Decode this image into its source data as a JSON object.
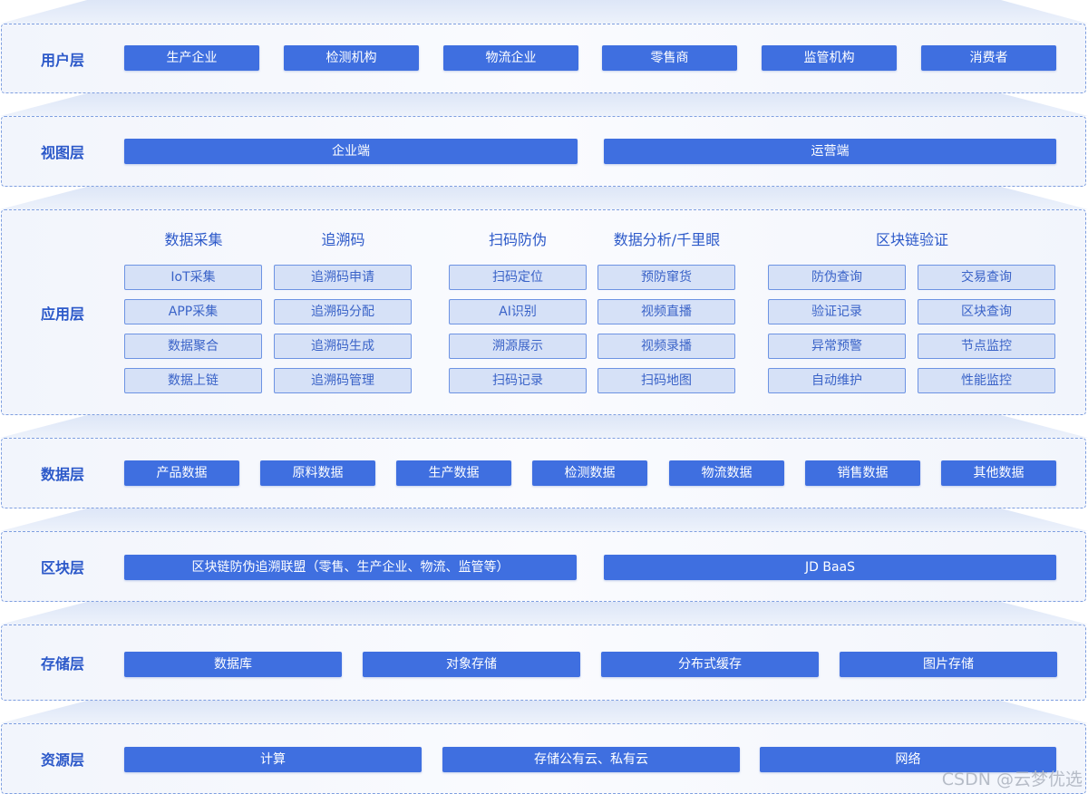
{
  "layers": {
    "user": {
      "label": "用户层",
      "items": [
        "生产企业",
        "检测机构",
        "物流企业",
        "零售商",
        "监管机构",
        "消费者"
      ]
    },
    "view": {
      "label": "视图层",
      "items": [
        "企业端",
        "运营端"
      ]
    },
    "app": {
      "label": "应用层",
      "groups": [
        {
          "title": "数据采集",
          "items": [
            "IoT采集",
            "APP采集",
            "数据聚合",
            "数据上链"
          ]
        },
        {
          "title": "追溯码",
          "items": [
            "追溯码申请",
            "追溯码分配",
            "追溯码生成",
            "追溯码管理"
          ]
        },
        {
          "title": "扫码防伪",
          "items": [
            "扫码定位",
            "AI识别",
            "溯源展示",
            "扫码记录"
          ]
        },
        {
          "title": "数据分析/千里眼",
          "items": [
            "预防窜货",
            "视频直播",
            "视频录播",
            "扫码地图"
          ]
        },
        {
          "title": "区块链验证",
          "items": [
            "防伪查询",
            "验证记录",
            "异常预警",
            "自动维护",
            "交易查询",
            "区块查询",
            "节点监控",
            "性能监控"
          ]
        }
      ]
    },
    "data": {
      "label": "数据层",
      "items": [
        "产品数据",
        "原料数据",
        "生产数据",
        "检测数据",
        "物流数据",
        "销售数据",
        "其他数据"
      ]
    },
    "block": {
      "label": "区块层",
      "items": [
        "区块链防伪追溯联盟（零售、生产企业、物流、监管等）",
        "JD BaaS"
      ]
    },
    "storage": {
      "label": "存储层",
      "items": [
        "数据库",
        "对象存储",
        "分布式缓存",
        "图片存储"
      ]
    },
    "resource": {
      "label": "资源层",
      "items": [
        "计算",
        "存储公有云、私有云",
        "网络"
      ]
    }
  },
  "watermark": "CSDN @云梦优选",
  "colors": {
    "accent": "#3f6fe0",
    "label": "#2c59c9",
    "sub_fill": "#d6e1f7",
    "sub_border": "#6d93e3",
    "border": "#7f9fe0"
  }
}
